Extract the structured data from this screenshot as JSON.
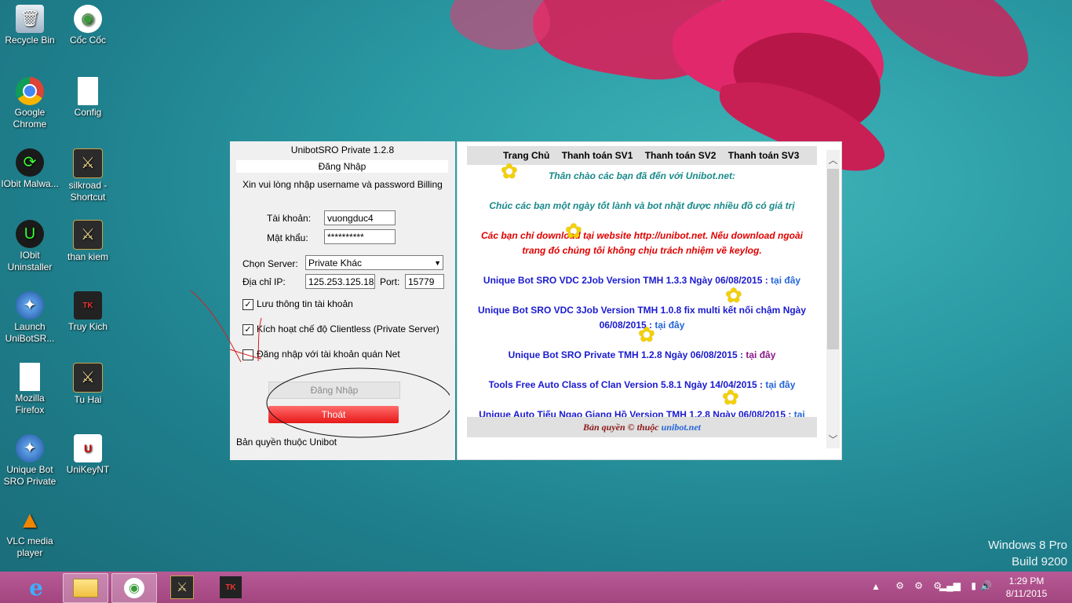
{
  "desktop_icons": [
    {
      "label": "Recycle Bin",
      "icon": "recycle-bin-icon"
    },
    {
      "label": "Cốc Cốc",
      "icon": "coccoc-icon"
    },
    {
      "label": "Google Chrome",
      "icon": "chrome-icon"
    },
    {
      "label": "Config",
      "icon": "file-icon"
    },
    {
      "label": "IObit Malwa...",
      "icon": "iobit-icon"
    },
    {
      "label": "silkroad - Shortcut",
      "icon": "silkroad-icon"
    },
    {
      "label": "IObit Uninstaller",
      "icon": "iobit-uninstaller-icon"
    },
    {
      "label": "than kiem",
      "icon": "silkroad-icon"
    },
    {
      "label": "Launch UniBotSR...",
      "icon": "unibot-icon"
    },
    {
      "label": "Truy Kich",
      "icon": "truykich-icon"
    },
    {
      "label": "Mozilla Firefox",
      "icon": "file-icon"
    },
    {
      "label": "Tu Hai",
      "icon": "silkroad-icon"
    },
    {
      "label": "Unique Bot SRO Private",
      "icon": "unibot-icon"
    },
    {
      "label": "UniKeyNT",
      "icon": "unikey-icon"
    },
    {
      "label": "VLC media player",
      "icon": "vlc-icon"
    }
  ],
  "watermark": {
    "line1": "Windows 8 Pro",
    "line2": "Build 9200"
  },
  "taskbar": {
    "time": "1:29 PM",
    "date": "8/11/2015"
  },
  "login": {
    "title": "UnibotSRO Private 1.2.8",
    "header": "Đăng Nhập",
    "prompt": "Xin vui lòng nhập username và password Billing",
    "account_label": "Tài khoản:",
    "account_value": "vuongduc4",
    "password_label": "Mật khẩu:",
    "password_value": "**********",
    "server_label": "Chọn Server:",
    "server_value": "Private Khác",
    "ip_label": "Địa chỉ IP:",
    "ip_value": "125.253.125.18",
    "port_label": "Port:",
    "port_value": "15779",
    "check1": "Lưu thông tin tài khoản",
    "check2": "Kích hoạt chế độ Clientless (Private Server)",
    "check3": "Đăng nhập với tài khoản quán Net",
    "login_button": "Đăng Nhập",
    "exit_button": "Thoát",
    "copyright": "Bản quyền thuộc Unibot"
  },
  "news": {
    "menu": [
      "Trang Chủ",
      "Thanh toán SV1",
      "Thanh toán SV2",
      "Thanh toán SV3"
    ],
    "welcome": "Thân chào các bạn đã đến với Unibot.net:",
    "wish": "Chúc các bạn một ngày tốt lành và bot nhặt được nhiều đồ có giá trị",
    "warning1": "Các bạn chỉ download tại website http://unibot.net. Nếu download ngoài",
    "warning2": "trang đó chúng tôi không chịu trách nhiệm về keylog.",
    "item1": "Unique Bot SRO VDC 2Job Version TMH 1.3.3 Ngày 06/08/2015 :",
    "item2a": "Unique Bot SRO VDC 3Job Version TMH 1.0.8 fix multi kết nối chậm Ngày",
    "item2b": "06/08/2015 :",
    "item3": "Unique Bot SRO Private TMH 1.2.8 Ngày 06/08/2015 :",
    "item4": "Tools Free Auto Class of Clan Version 5.8.1 Ngày 14/04/2015 :",
    "item5": "Unique Auto Tiếu Ngạo Giang Hồ Version TMH 1.2.8 Ngày 06/08/2015 :",
    "link_text": "tại đây",
    "link_text_cut": "tại",
    "footer_text": "Bản quyền © thuộc",
    "footer_link": "unibot.net"
  },
  "colors": {
    "taskbar": "#b04e8d",
    "exit_button": "#e81818",
    "teal_text": "#1a8a8a",
    "red_text": "#e00000",
    "blue_text": "#1a1acf"
  }
}
